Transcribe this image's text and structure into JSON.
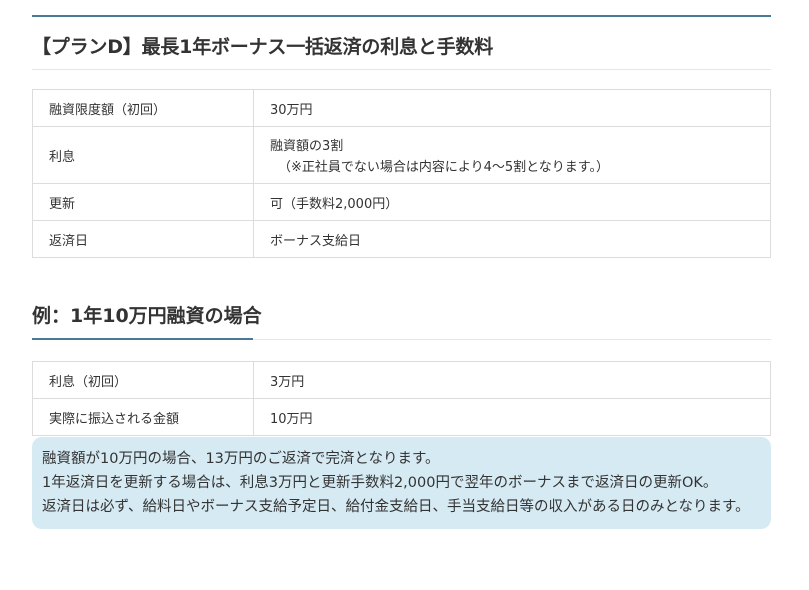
{
  "section1": {
    "heading": "【プランD】最長1年ボーナス一括返済の利息と手数料",
    "rows": [
      {
        "key": "融資限度額（初回）",
        "value": "30万円",
        "value2": ""
      },
      {
        "key": "利息",
        "value": "融資額の3割",
        "value2": "（※正社員でない場合は内容により4〜5割となります。）"
      },
      {
        "key": "更新",
        "value": "可（手数料2,000円）",
        "value2": ""
      },
      {
        "key": "返済日",
        "value": "ボーナス支給日",
        "value2": ""
      }
    ]
  },
  "section2": {
    "heading": "例：1年10万円融資の場合",
    "rows": [
      {
        "key": "利息（初回）",
        "value": "3万円"
      },
      {
        "key": "実際に振込される金額",
        "value": "10万円"
      }
    ]
  },
  "note": {
    "line1": "融資額が10万円の場合、13万円のご返済で完済となります。",
    "line2": "1年返済日を更新する場合は、利息3万円と更新手数料2,000円で翌年のボーナスまで返済日の更新OK。",
    "line3": "返済日は必ず、給料日やボーナス支給予定日、給付金支給日、手当支給日等の収入がある日のみとなります。"
  }
}
